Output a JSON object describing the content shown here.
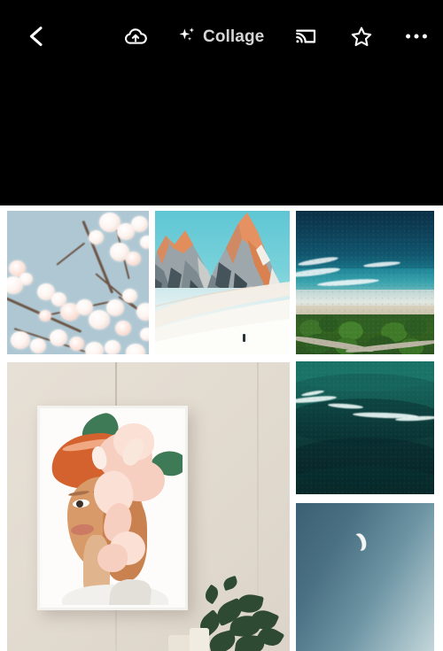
{
  "app": {
    "background_color": "#000000",
    "surface_color": "#ffffff"
  },
  "toolbar": {
    "back_label": "Back",
    "back_icon": "chevron-left-icon",
    "upload_label": "Back up",
    "upload_icon": "cloud-upload-icon",
    "collage_label": "Collage",
    "collage_icon": "sparkle-icon",
    "cast_label": "Cast",
    "cast_icon": "chromecast-icon",
    "favorite_label": "Favorite",
    "favorite_icon": "star-outline-icon",
    "more_label": "More options",
    "more_icon": "more-horizontal-icon",
    "text_color": "#d6d6d6",
    "icon_color": "#ffffff"
  },
  "collage": {
    "title": "Collage",
    "tile_count": 6,
    "tiles": [
      {
        "id": "tile-1",
        "name": "cherry-blossom-photo",
        "description": "White cherry blossom branches against pale blue sky",
        "accent": "#aec7d2",
        "position": "row1-col1"
      },
      {
        "id": "tile-2",
        "name": "snow-mountain-photo",
        "description": "Sunlit rocky mountain peaks above a snow field with a lone hiker",
        "accent": "#79d2da",
        "position": "row1-col2"
      },
      {
        "id": "tile-3",
        "name": "aerial-beach-photo",
        "description": "Aerial view of turquoise reef, breaking surf, sand and green forest",
        "accent": "#10566e",
        "position": "row1-col3"
      },
      {
        "id": "tile-4",
        "name": "framed-portrait-photo",
        "description": "Framed painting of a woman with pink flowers on a beige wall beside a plant",
        "accent": "#e2dbd0",
        "position": "row2-col1"
      },
      {
        "id": "tile-5",
        "name": "ocean-wave-photo",
        "description": "Dark teal ocean wave with white foam crest",
        "accent": "#0e3f3d",
        "position": "row2-col3"
      },
      {
        "id": "tile-6",
        "name": "crescent-moon-photo",
        "description": "Crescent moon in a blue gradient daytime sky",
        "accent": "#6b93a2",
        "position": "row3-col3"
      }
    ]
  }
}
